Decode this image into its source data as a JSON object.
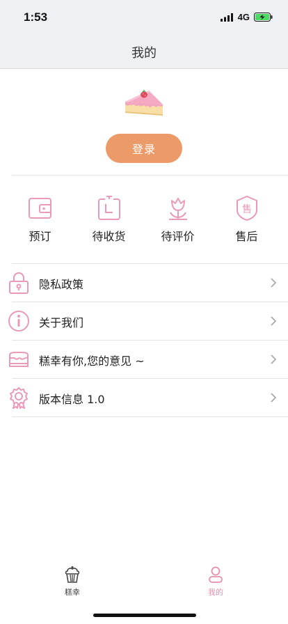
{
  "status": {
    "time": "1:53",
    "network": "4G"
  },
  "nav": {
    "title": "我的"
  },
  "profile": {
    "login_label": "登录"
  },
  "orders": [
    {
      "label": "预订",
      "icon": "wallet-icon"
    },
    {
      "label": "待收货",
      "icon": "package-icon"
    },
    {
      "label": "待评价",
      "icon": "flower-icon"
    },
    {
      "label": "售后",
      "icon": "shield-icon"
    }
  ],
  "menu": [
    {
      "label": "隐私政策",
      "icon": "lock-icon"
    },
    {
      "label": "关于我们",
      "icon": "info-icon"
    },
    {
      "label": "糕幸有你,您的意见 ~",
      "icon": "cake-box-icon"
    },
    {
      "label": "版本信息 1.0",
      "icon": "badge-icon"
    }
  ],
  "tabs": [
    {
      "label": "糕幸",
      "icon": "cupcake-icon",
      "active": false
    },
    {
      "label": "我的",
      "icon": "user-icon",
      "active": true
    }
  ],
  "colors": {
    "accent": "#ec9a68",
    "pink": "#e89ab8",
    "active_tab": "#e58fae",
    "inactive_tab": "#444444"
  }
}
